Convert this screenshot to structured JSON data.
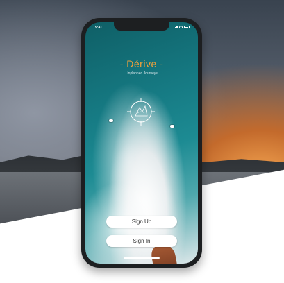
{
  "status_bar": {
    "time": "9:41"
  },
  "app": {
    "title": "- Dérive -",
    "subtitle": "Unplanned Journeys"
  },
  "buttons": {
    "sign_up": "Sign Up",
    "sign_in": "Sign In"
  },
  "colors": {
    "accent": "#f2a13a",
    "phone_frame": "#1d1f21",
    "button_bg": "#ffffff",
    "sea": "#167b84"
  },
  "icons": [
    "compass-logo-icon",
    "signal-icon",
    "wifi-icon",
    "battery-icon"
  ]
}
